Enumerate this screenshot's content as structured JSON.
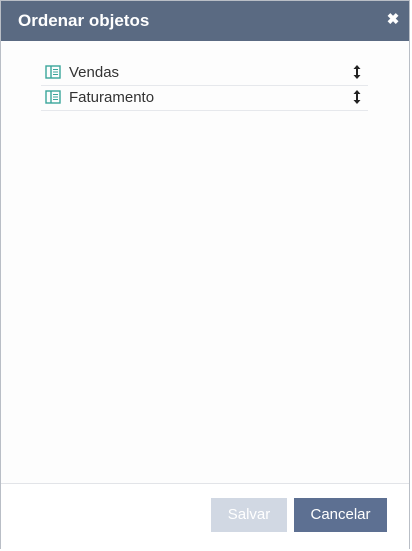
{
  "dialog": {
    "title": "Ordenar objetos",
    "close_icon": "close-icon"
  },
  "objects": [
    {
      "label": "Vendas",
      "icon": "book-icon",
      "handle_icon": "vertical-arrows-icon"
    },
    {
      "label": "Faturamento",
      "icon": "book-icon",
      "handle_icon": "vertical-arrows-icon"
    }
  ],
  "footer": {
    "save_label": "Salvar",
    "save_enabled": false,
    "cancel_label": "Cancelar"
  },
  "colors": {
    "header": "#5a6a82",
    "icon_teal": "#3aa59b",
    "save_disabled": "#d1d8e3",
    "cancel": "#5d7092"
  }
}
